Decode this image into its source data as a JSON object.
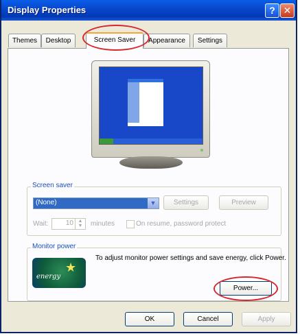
{
  "window": {
    "title": "Display Properties"
  },
  "title_buttons": {
    "help": "?",
    "close": "✕"
  },
  "tabs": [
    {
      "label": "Themes"
    },
    {
      "label": "Desktop"
    },
    {
      "label": "Screen Saver",
      "active": true
    },
    {
      "label": "Appearance"
    },
    {
      "label": "Settings"
    }
  ],
  "screen_saver": {
    "group_label": "Screen saver",
    "selected": "(None)",
    "settings_button": "Settings",
    "preview_button": "Preview",
    "wait_label": "Wait:",
    "wait_value": "10",
    "minutes_label": "minutes",
    "resume_label": "On resume, password protect"
  },
  "monitor_power": {
    "group_label": "Monitor power",
    "logo_text": "energy",
    "message": "To adjust monitor power settings and save energy, click Power.",
    "power_button": "Power..."
  },
  "dialog_buttons": {
    "ok": "OK",
    "cancel": "Cancel",
    "apply": "Apply"
  },
  "colors": {
    "title_bar": "#0846c9",
    "highlight_oval": "#d6272d",
    "tab_accent": "#f3a53c"
  }
}
